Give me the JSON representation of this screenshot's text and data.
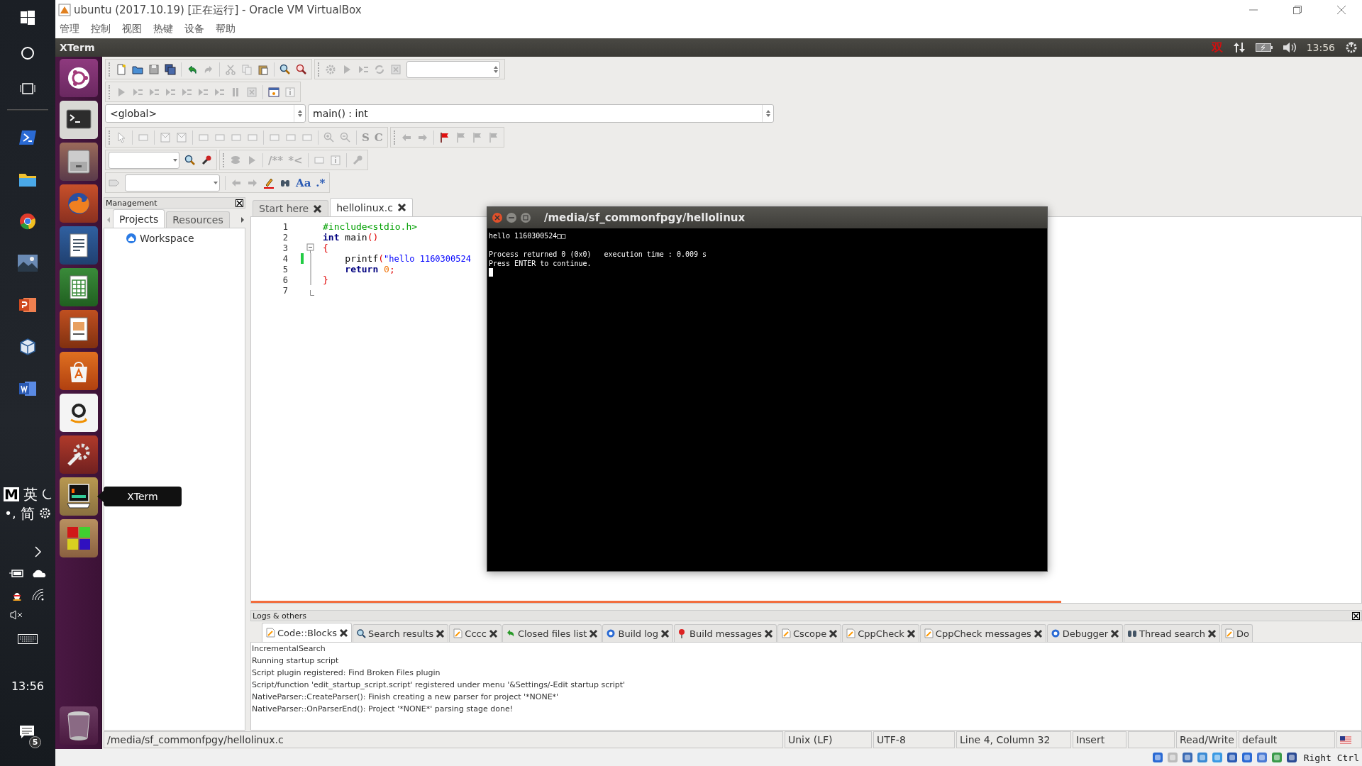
{
  "host_taskbar": {
    "ime": {
      "mode": "M",
      "language": "英",
      "punctuation": "•,",
      "script": "简"
    },
    "clock": "13:56",
    "notification_count": "5"
  },
  "window": {
    "title": "ubuntu (2017.10.19) [正在运行] - Oracle VM VirtualBox",
    "menu": [
      "管理",
      "控制",
      "视图",
      "热键",
      "设备",
      "帮助"
    ]
  },
  "guest_panel": {
    "app_title": "XTerm",
    "input_method": "双",
    "clock": "13:56"
  },
  "launcher": {
    "tooltip": "XTerm"
  },
  "toolbar_symbols": {
    "code": [
      "S",
      "C"
    ],
    "doxygen": [
      "/**",
      "*<"
    ],
    "search": [
      "Aa",
      ".*"
    ]
  },
  "scope_bar": {
    "scope": "<global>",
    "symbol": "main() : int"
  },
  "management": {
    "title": "Management",
    "tabs": [
      {
        "label": "Projects",
        "selected": true
      },
      {
        "label": "Resources",
        "selected": false
      }
    ],
    "tree": [
      {
        "label": "Workspace"
      }
    ]
  },
  "editor": {
    "tabs": [
      {
        "label": "Start here",
        "selected": false
      },
      {
        "label": "hellolinux.c",
        "selected": true
      }
    ],
    "progress": {
      "level": 0.73
    },
    "lines": [
      {
        "number": "1",
        "modified": false,
        "kind": "plain",
        "tokens": [
          {
            "kind": "preprocessor",
            "text": "#include<stdio.h>"
          }
        ]
      },
      {
        "number": "2",
        "modified": false,
        "kind": "plain",
        "tokens": [
          {
            "kind": "keyword",
            "text": "int"
          },
          {
            "kind": "plain",
            "text": " main"
          },
          {
            "kind": "operator",
            "text": "()"
          }
        ]
      },
      {
        "number": "3",
        "modified": false,
        "kind": "foldstart",
        "tokens": [
          {
            "kind": "operator",
            "text": "{"
          }
        ]
      },
      {
        "number": "4",
        "modified": true,
        "kind": "folded",
        "tokens": [
          {
            "kind": "plain",
            "text": "    printf"
          },
          {
            "kind": "operator",
            "text": "("
          },
          {
            "kind": "string",
            "text": "\"hello 1160300524"
          }
        ]
      },
      {
        "number": "5",
        "modified": false,
        "kind": "folded",
        "tokens": [
          {
            "kind": "keyword",
            "text": "    return "
          },
          {
            "kind": "number",
            "text": "0"
          },
          {
            "kind": "operator",
            "text": ";"
          }
        ]
      },
      {
        "number": "6",
        "modified": false,
        "kind": "folded",
        "tokens": [
          {
            "kind": "operator",
            "text": "}"
          }
        ]
      },
      {
        "number": "7",
        "modified": false,
        "kind": "foldend"
      }
    ]
  },
  "terminal": {
    "title": "/media/sf_commonfpgy/hellolinux",
    "lines": [
      {
        "text": "hello 1160300524□□",
        "gap_before": false
      },
      {
        "text": "Process returned 0 (0x0)   execution time : 0.009 s",
        "gap_before": true
      },
      {
        "text": "Press ENTER to continue.",
        "gap_before": false
      }
    ]
  },
  "logs": {
    "title": "Logs & others",
    "tabs": [
      {
        "label": "Code::Blocks",
        "selected": true
      },
      {
        "label": "Search results",
        "selected": false
      },
      {
        "label": "Cccc",
        "selected": false
      },
      {
        "label": "Closed files list",
        "selected": false
      },
      {
        "label": "Build log",
        "selected": false
      },
      {
        "label": "Build messages",
        "selected": false
      },
      {
        "label": "Cscope",
        "selected": false
      },
      {
        "label": "CppCheck",
        "selected": false
      },
      {
        "label": "CppCheck messages",
        "selected": false
      },
      {
        "label": "Debugger",
        "selected": false
      },
      {
        "label": "Thread search",
        "selected": false
      },
      {
        "label": "Do",
        "selected": false
      }
    ],
    "lines": [
      "IncrementalSearch",
      "Running startup script",
      "Script plugin registered: Find Broken Files plugin",
      "Script/function 'edit_startup_script.script' registered under menu '&Settings/-Edit startup script'",
      "NativeParser::CreateParser(): Finish creating a new parser for project '*NONE*'",
      "NativeParser::OnParserEnd(): Project '*NONE*' parsing stage done!"
    ]
  },
  "status_bar": {
    "path": "/media/sf_commonfpgy/hellolinux.c",
    "line_endings": "Unix (LF)",
    "encoding": "UTF-8",
    "position": "Line 4, Column 32",
    "mode": "Insert",
    "access": "Read/Write",
    "profile": "default"
  },
  "vbox_status": {
    "host_key": "Right Ctrl"
  }
}
